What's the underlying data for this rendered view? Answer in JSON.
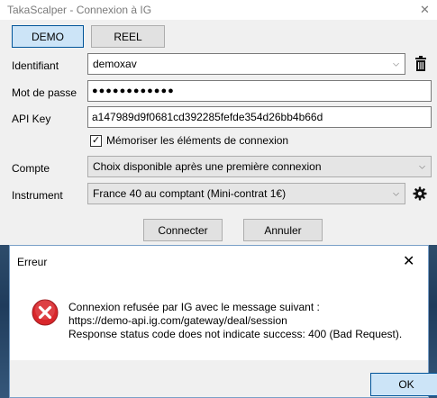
{
  "window": {
    "title": "TakaScalper - Connexion à IG",
    "close": "✕"
  },
  "mode": {
    "demo_label": "DEMO",
    "reel_label": "REEL",
    "selected": "DEMO"
  },
  "form": {
    "identifiant_label": "Identifiant",
    "identifiant_value": "demoxav",
    "password_label": "Mot de passe",
    "password_value": "●●●●●●●●●●●●",
    "apikey_label": "API Key",
    "apikey_value": "a147989d9f0681cd392285fefde354d26bb4b66d",
    "remember_label": "Mémoriser les éléments de connexion",
    "remember_checked": true,
    "compte_label": "Compte",
    "compte_value": "Choix disponible après une première connexion",
    "instrument_label": "Instrument",
    "instrument_value": "France 40 au comptant (Mini-contrat 1€)"
  },
  "actions": {
    "connect_label": "Connecter",
    "cancel_label": "Annuler"
  },
  "dialog": {
    "title": "Erreur",
    "close": "✕",
    "line1": "Connexion refusée par IG avec le message suivant :",
    "line2": "https://demo-api.ig.com/gateway/deal/session",
    "line3": "Response status code does not indicate success: 400 (Bad Request).",
    "ok_label": "OK"
  },
  "colors": {
    "error_red": "#d9262b",
    "accent_blue": "#005499"
  }
}
